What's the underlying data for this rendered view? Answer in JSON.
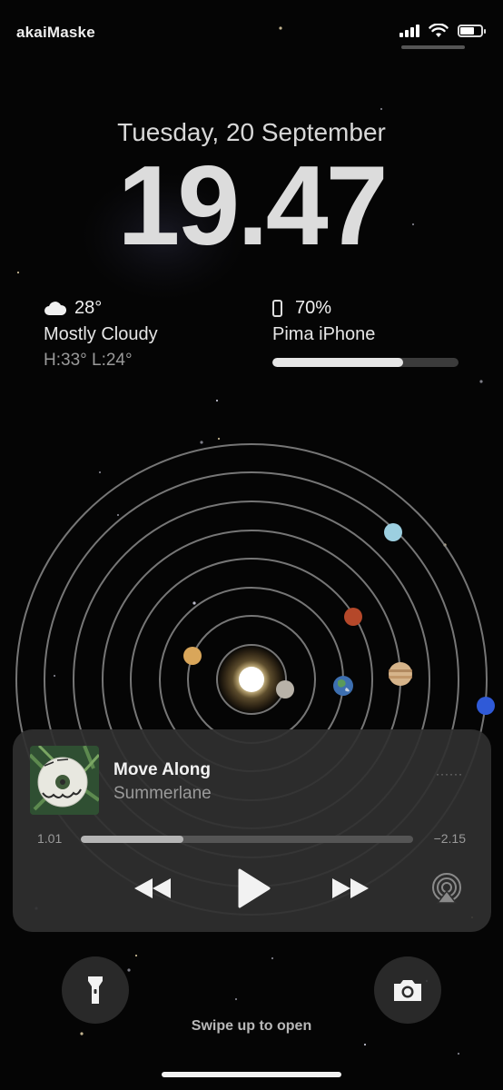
{
  "status_bar": {
    "carrier": "akaiMaske",
    "signal_bars": 4,
    "wifi_icon": "wifi-icon",
    "battery_level": 0.7
  },
  "lock_screen": {
    "date": "Tuesday, 20 September",
    "time": "19.47"
  },
  "weather_widget": {
    "icon": "cloud-icon",
    "temperature": "28°",
    "condition": "Mostly Cloudy",
    "high_low": "H:33° L:24°"
  },
  "battery_widget": {
    "icon": "iphone-icon",
    "percent": "70%",
    "device": "Pima iPhone",
    "level": 0.7
  },
  "wallpaper": {
    "type": "solar-system",
    "planet_colors": {
      "sun": "#fff5c8",
      "mercury": "#b8b2a8",
      "venus": "#d9a65a",
      "earth": "#3d6fb0",
      "mars": "#b5482a",
      "jupiter": "#d6b48a",
      "saturn": "#cdb07a",
      "uranus": "#9ccfe0",
      "neptune": "#2f5ad8"
    }
  },
  "now_playing": {
    "album_art": "Summerlane album cover",
    "title": "Move Along",
    "artist": "Summerlane",
    "elapsed": "1.01",
    "remaining": "−2.15",
    "progress": 0.31,
    "controls": {
      "previous": "rewind-icon",
      "play": "play-icon",
      "next": "fast-forward-icon",
      "airplay": "airplay-icon"
    }
  },
  "quick_actions": {
    "left": "flashlight-icon",
    "right": "camera-icon"
  },
  "footer": {
    "swipe_hint": "Swipe up to open"
  },
  "accent_colors": {
    "background": "#050505",
    "widget_text": "#e6e6e6",
    "secondary_text": "#9a9a9a"
  }
}
